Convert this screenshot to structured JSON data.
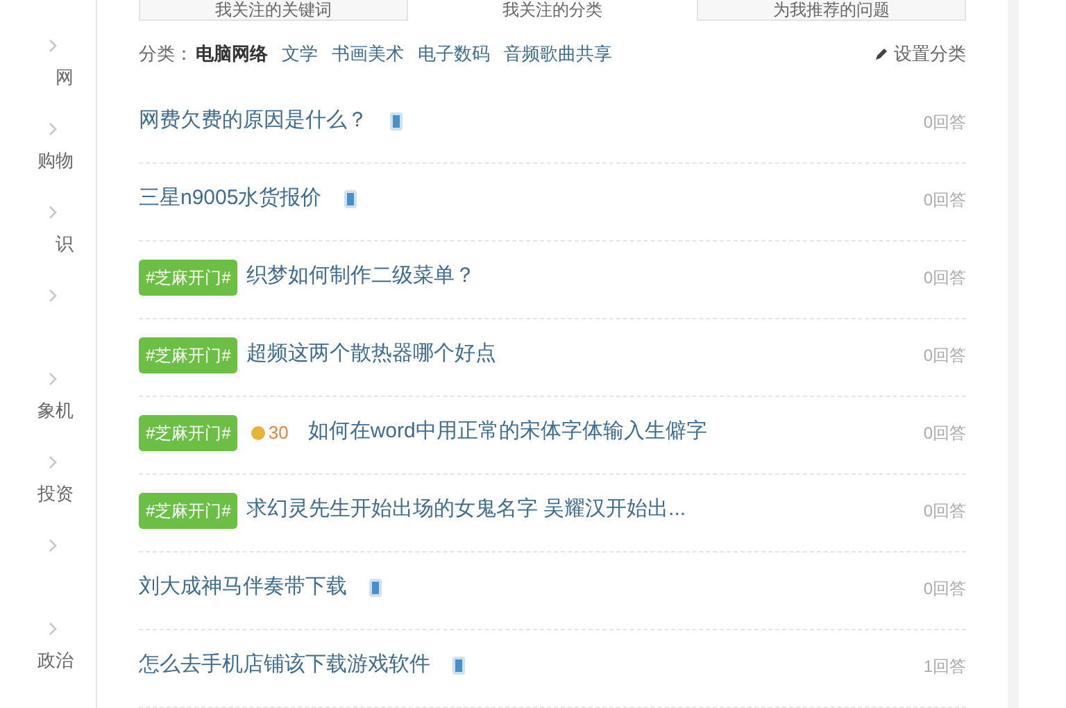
{
  "sidebar": {
    "items": [
      {
        "kind": "labeled",
        "label": "网"
      },
      {
        "kind": "labeled",
        "label": "购物"
      },
      {
        "kind": "labeled",
        "label": "识"
      },
      {
        "kind": "chevron"
      },
      {
        "kind": "labeled",
        "label": "象机"
      },
      {
        "kind": "labeled",
        "label": "投资"
      },
      {
        "kind": "chevron"
      },
      {
        "kind": "labeled",
        "label": "政治"
      }
    ]
  },
  "tabs": [
    {
      "label": "我关注的关键词",
      "selected": false
    },
    {
      "label": "我关注的分类",
      "selected": true
    },
    {
      "label": "为我推荐的问题",
      "selected": false
    }
  ],
  "categories": {
    "label": "分类：",
    "items": [
      {
        "label": "电脑网络",
        "selected": true
      },
      {
        "label": "文学",
        "selected": false
      },
      {
        "label": "书画美术",
        "selected": false
      },
      {
        "label": "电子数码",
        "selected": false
      },
      {
        "label": "音频歌曲共享",
        "selected": false
      }
    ],
    "settings_link": "设置分类"
  },
  "questions": [
    {
      "title": "网费欠费的原因是什么？",
      "mobile": true,
      "answers": "0回答"
    },
    {
      "title": "三星n9005水货报价",
      "mobile": true,
      "answers": "0回答"
    },
    {
      "badge": "#芝麻开门#",
      "title": "织梦如何制作二级菜单？",
      "mobile": false,
      "answers": "0回答"
    },
    {
      "badge": "#芝麻开门#",
      "title": "超频这两个散热器哪个好点",
      "mobile": false,
      "answers": "0回答"
    },
    {
      "badge": "#芝麻开门#",
      "reward": "30",
      "title": "如何在word中用正常的宋体字体输入生僻字",
      "mobile": false,
      "answers": "0回答"
    },
    {
      "badge": "#芝麻开门#",
      "title": "求幻灵先生开始出场的女鬼名字 吴耀汉开始出...",
      "mobile": false,
      "answers": "0回答"
    },
    {
      "title": "刘大成神马伴奏带下载",
      "mobile": true,
      "answers": "0回答"
    },
    {
      "title": "怎么去手机店铺该下载游戏软件",
      "mobile": true,
      "answers": "1回答"
    }
  ]
}
